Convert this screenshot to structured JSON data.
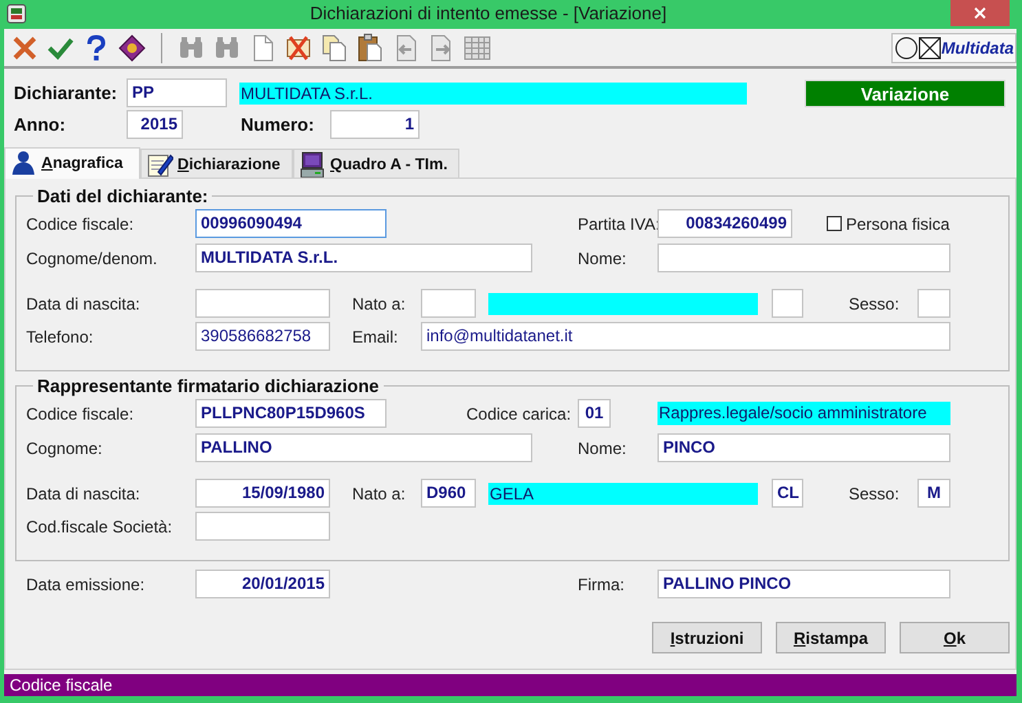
{
  "window": {
    "title": "Dichiarazioni di intento emesse - [Variazione]"
  },
  "toolbar": {
    "tools": [
      {
        "kind": "cancel",
        "disabled": false
      },
      {
        "kind": "confirm",
        "disabled": false
      },
      {
        "kind": "help",
        "disabled": false
      },
      {
        "kind": "book",
        "disabled": false
      },
      {
        "kind": "find",
        "disabled": true
      },
      {
        "kind": "find",
        "disabled": true
      },
      {
        "kind": "new",
        "disabled": true
      },
      {
        "kind": "delete",
        "disabled": false
      },
      {
        "kind": "copy",
        "disabled": false
      },
      {
        "kind": "paste",
        "disabled": false
      },
      {
        "kind": "import",
        "disabled": true
      },
      {
        "kind": "export",
        "disabled": true
      },
      {
        "kind": "grid",
        "disabled": true
      }
    ],
    "logo": "Multidata"
  },
  "header": {
    "dichiarante_label": "Dichiarante:",
    "dichiarante_code": "PP",
    "dichiarante_name": "MULTIDATA S.r.L.",
    "mode": "Variazione",
    "anno_label": "Anno:",
    "anno": "2015",
    "numero_label": "Numero:",
    "numero": "1"
  },
  "tabs": [
    {
      "label": "Anagrafica",
      "kind": "person",
      "selected": true
    },
    {
      "label": "Dichiarazione",
      "kind": "notepad",
      "selected": false
    },
    {
      "label": "Quadro A - TIm.",
      "kind": "computer",
      "selected": false
    }
  ],
  "dichiarante": {
    "title": "Dati del dichiarante:",
    "codice_fiscale_label": "Codice fiscale:",
    "codice_fiscale": "00996090494",
    "codice_fiscale_focused": true,
    "partita_iva_label": "Partita IVA:",
    "partita_iva": "00834260499",
    "persona_fisica_label": "Persona fisica",
    "persona_fisica_checked": false,
    "cognome_label": "Cognome/denom.",
    "cognome": "MULTIDATA S.r.L.",
    "nome_label": "Nome:",
    "nascita_label": "Data di nascita:",
    "nato_label": "Nato a:",
    "sesso_label": "Sesso:",
    "telefono_label": "Telefono:",
    "telefono": "390586682758",
    "email_label": "Email:",
    "email": "info@multidatanet.it"
  },
  "rappresentante": {
    "title": "Rappresentante firmatario dichiarazione",
    "codice_fiscale_label": "Codice fiscale:",
    "codice_fiscale": "PLLPNC80P15D960S",
    "carica_label": "Codice carica:",
    "carica_code": "01",
    "carica_desc": "Rappres.legale/socio amministratore",
    "cognome_label": "Cognome:",
    "cognome": "PALLINO",
    "nome_label": "Nome:",
    "nome": "PINCO",
    "nascita_label": "Data di nascita:",
    "nascita": "15/09/1980",
    "nato_label": "Nato a:",
    "nato_code": "D960",
    "nato_city": "GELA",
    "provincia": "CL",
    "sesso_label": "Sesso:",
    "sesso": "M",
    "cf_societa_label": "Cod.fiscale Società:"
  },
  "emissione": {
    "data_label": "Data emissione:",
    "data": "20/01/2015",
    "firma_label": "Firma:",
    "firma": "PALLINO PINCO"
  },
  "buttons": [
    {
      "label": "Istruzioni"
    },
    {
      "label": "Ristampa"
    },
    {
      "label": "Ok"
    }
  ],
  "status_bar": {
    "text": "Codice fiscale"
  }
}
